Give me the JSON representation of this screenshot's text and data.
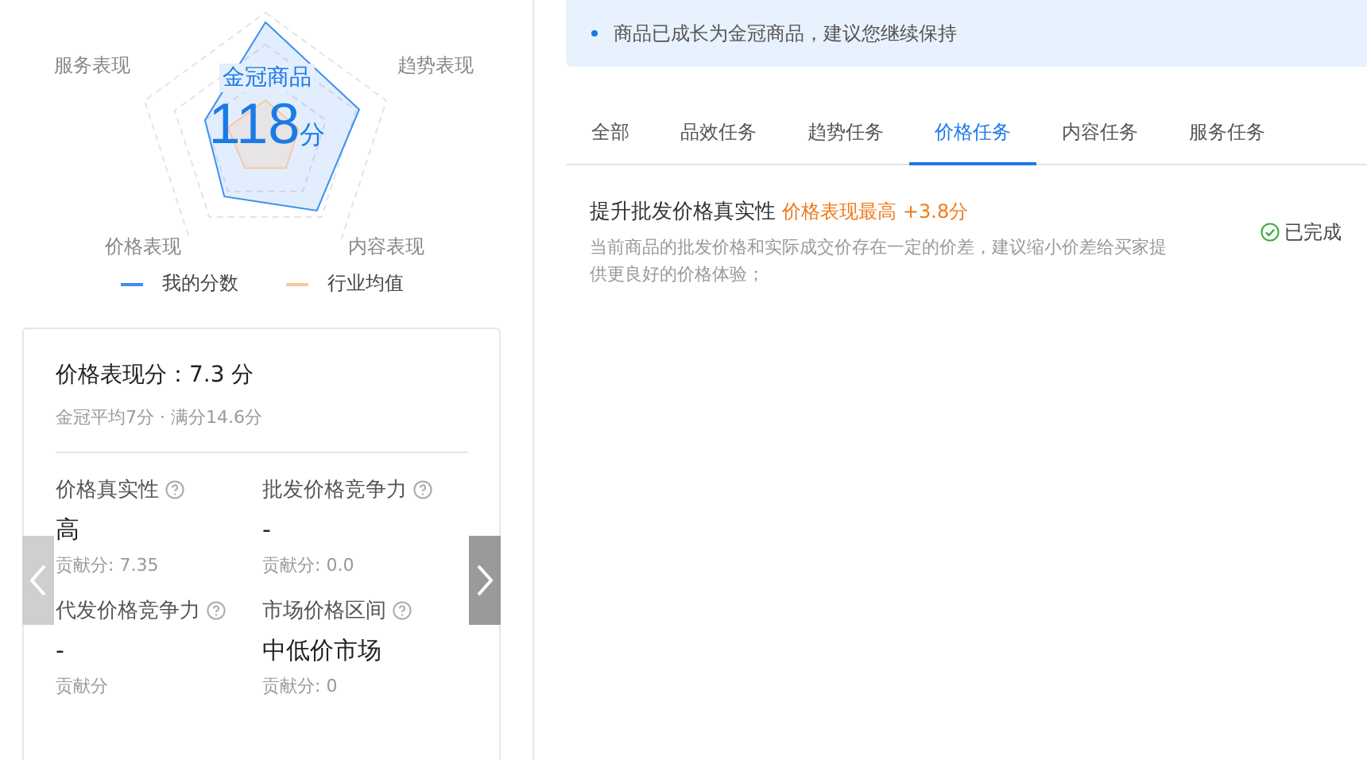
{
  "radar": {
    "center_title": "金冠商品",
    "score": "118",
    "score_unit": "分",
    "axes": [
      "服务表现",
      "趋势表现",
      "价格表现",
      "内容表现"
    ],
    "legend": [
      {
        "label": "我的分数",
        "color": "#3d8ff0"
      },
      {
        "label": "行业均值",
        "color": "#f8c8a0"
      }
    ]
  },
  "detail_card": {
    "title": "价格表现分：7.3 分",
    "subtitle": "金冠平均7分 · 满分14.6分",
    "metrics": [
      {
        "label": "价格真实性",
        "value": "高",
        "contribution": "贡献分: 7.35"
      },
      {
        "label": "批发价格竞争力",
        "value": "-",
        "contribution": "贡献分: 0.0"
      },
      {
        "label": "代发价格竞争力",
        "value": "-",
        "contribution": "贡献分"
      },
      {
        "label": "市场价格区间",
        "value": "中低价市场",
        "contribution": "贡献分: 0"
      }
    ]
  },
  "notice": {
    "text": "商品已成长为金冠商品，建议您继续保持"
  },
  "tabs": [
    {
      "label": "全部",
      "selected": false
    },
    {
      "label": "品效任务",
      "selected": false
    },
    {
      "label": "趋势任务",
      "selected": false
    },
    {
      "label": "价格任务",
      "selected": true
    },
    {
      "label": "内容任务",
      "selected": false
    },
    {
      "label": "服务任务",
      "selected": false
    }
  ],
  "tasks": [
    {
      "title": "提升批发价格真实性",
      "tag": "价格表现最高 +3.8分",
      "description": "当前商品的批发价格和实际成交价存在一定的价差，建议缩小价差给买家提供更良好的价格体验；",
      "status": "已完成",
      "completed": true
    }
  ]
}
